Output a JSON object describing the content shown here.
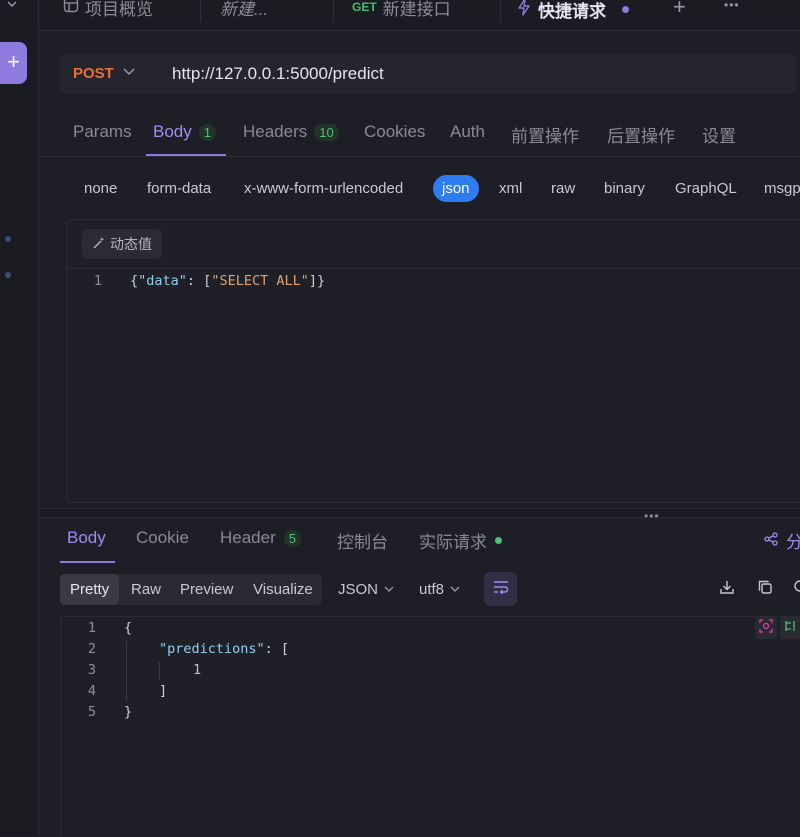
{
  "rail": {
    "add_label": "+"
  },
  "tabs": [
    {
      "label": "项目概览"
    },
    {
      "label": "新建..."
    },
    {
      "method": "GET",
      "label": "新建接口"
    },
    {
      "label": "快捷请求"
    }
  ],
  "tab_actions": {
    "add": "+",
    "more": "•••"
  },
  "request": {
    "method": "POST",
    "url": "http://127.0.0.1:5000/predict"
  },
  "request_tabs": [
    {
      "label": "Params"
    },
    {
      "label": "Body",
      "count": "1"
    },
    {
      "label": "Headers",
      "count": "10"
    },
    {
      "label": "Cookies"
    },
    {
      "label": "Auth"
    },
    {
      "label": "前置操作"
    },
    {
      "label": "后置操作"
    },
    {
      "label": "设置"
    }
  ],
  "body_types": [
    "none",
    "form-data",
    "x-www-form-urlencoded",
    "json",
    "xml",
    "raw",
    "binary",
    "GraphQL",
    "msgp"
  ],
  "body_type_selected": "json",
  "dynamic_value_label": "动态值",
  "request_body": {
    "line": "1",
    "brace_open": "{",
    "key": "\"data\"",
    "colon": ": [",
    "value": "\"SELECT ALL\"",
    "close": "]}"
  },
  "response_tabs": [
    {
      "label": "Body"
    },
    {
      "label": "Cookie"
    },
    {
      "label": "Header",
      "count": "5"
    },
    {
      "label": "控制台"
    },
    {
      "label": "实际请求"
    }
  ],
  "share_label": "分",
  "view_modes": [
    "Pretty",
    "Raw",
    "Preview",
    "Visualize"
  ],
  "format_select": "JSON",
  "encoding_select": "utf8",
  "response_body": {
    "lines": [
      "1",
      "2",
      "3",
      "4",
      "5"
    ],
    "l1": "{",
    "l2_key": "\"predictions\"",
    "l2_rest": ": [",
    "l3": "1",
    "l4": "]",
    "l5": "}"
  },
  "colors": {
    "accent": "#8f7be0",
    "method_post": "#f26b3a",
    "method_get": "#3fbf6a",
    "json_pill": "#2f7bf0",
    "success": "#49c27a"
  }
}
